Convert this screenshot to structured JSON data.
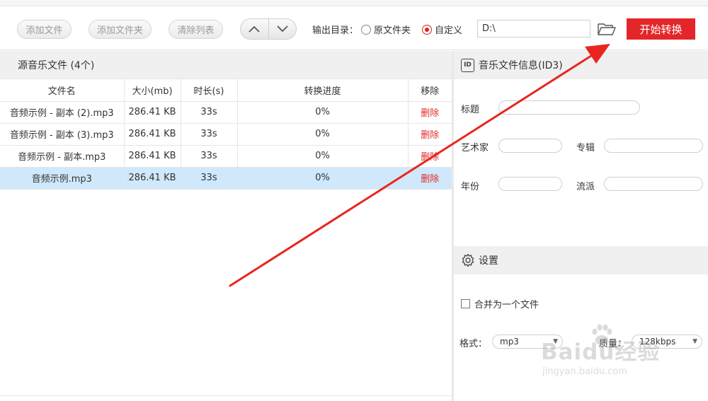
{
  "toolbar": {
    "add_file": "添加文件",
    "add_folder": "添加文件夹",
    "clear_list": "清除列表",
    "output_label": "输出目录：",
    "radio_original": "原文件夹",
    "radio_custom": "自定义",
    "radio_selected": "自定义",
    "output_path": "D:\\",
    "start_button": "开始转换",
    "accent_color": "#e3262a"
  },
  "file_list": {
    "title": "源音乐文件 (4个)",
    "columns": [
      "文件名",
      "大小(mb)",
      "时长(s)",
      "转换进度",
      "移除"
    ],
    "rows": [
      {
        "name": "音频示例 - 副本 (2).mp3",
        "size": "286.41 KB",
        "duration": "33s",
        "progress": "0%",
        "remove": "删除"
      },
      {
        "name": "音频示例 - 副本 (3).mp3",
        "size": "286.41 KB",
        "duration": "33s",
        "progress": "0%",
        "remove": "删除"
      },
      {
        "name": "音频示例 - 副本.mp3",
        "size": "286.41 KB",
        "duration": "33s",
        "progress": "0%",
        "remove": "删除"
      },
      {
        "name": "音频示例.mp3",
        "size": "286.41 KB",
        "duration": "33s",
        "progress": "0%",
        "remove": "删除"
      }
    ],
    "selected_row": 3
  },
  "id3": {
    "icon_text": "ID",
    "title": "音乐文件信息(ID3)",
    "label_title": "标题",
    "label_artist": "艺术家",
    "label_album": "专辑",
    "label_year": "年份",
    "label_genre": "流派"
  },
  "settings": {
    "title": "设置",
    "merge_label": "合并为一个文件",
    "format_label": "格式：",
    "format_value": "mp3",
    "quality_label": "质量：",
    "quality_value": "128kbps"
  },
  "watermark": {
    "brand": "Baidu经验",
    "url": "jingyan.baidu.com"
  }
}
